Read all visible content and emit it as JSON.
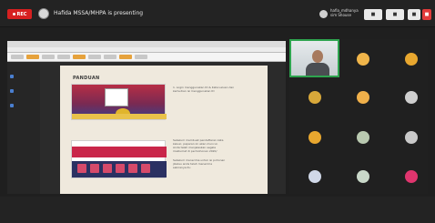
{
  "toolbar": {
    "rec_label": "REC",
    "presenter_text": "Hafida MSSA/MHPA is presenting",
    "me_name": "hafia_mdhanya sim Shouse",
    "ctrl1": "■",
    "ctrl2": "■",
    "ctrl3": "■",
    "ctrl4": "■"
  },
  "slide": {
    "title": "PANDUAN",
    "text_1": "1. Login menggunakan ID & Kata Laluan dan\nkemudian isi menggunakan ID",
    "text_2": "Sebelum membuat pendaftaran kata\nkeluar, paparan ini akan muncul.\nAnda telah menjelaskan segala\nmaklumat di permohonan 2020/",
    "text_3": "Sebelum menerima untuk isi pohonan\njikalau anda telah menerima\nsekiranya itu"
  },
  "participants": {
    "tile_colors": [
      "#f0b54a",
      "#e8a72f",
      "#d8a83a",
      "#f0b04a",
      "#cfcfcf",
      "#e8a72f",
      "#b9c9b0",
      "#c9c9c9",
      "#d0d8e8",
      "#c9d8c9",
      "#e0356e",
      "#d8c8a0"
    ]
  },
  "colors": {
    "record_red": "#d62020",
    "active_speaker_green": "#2ea44f"
  }
}
